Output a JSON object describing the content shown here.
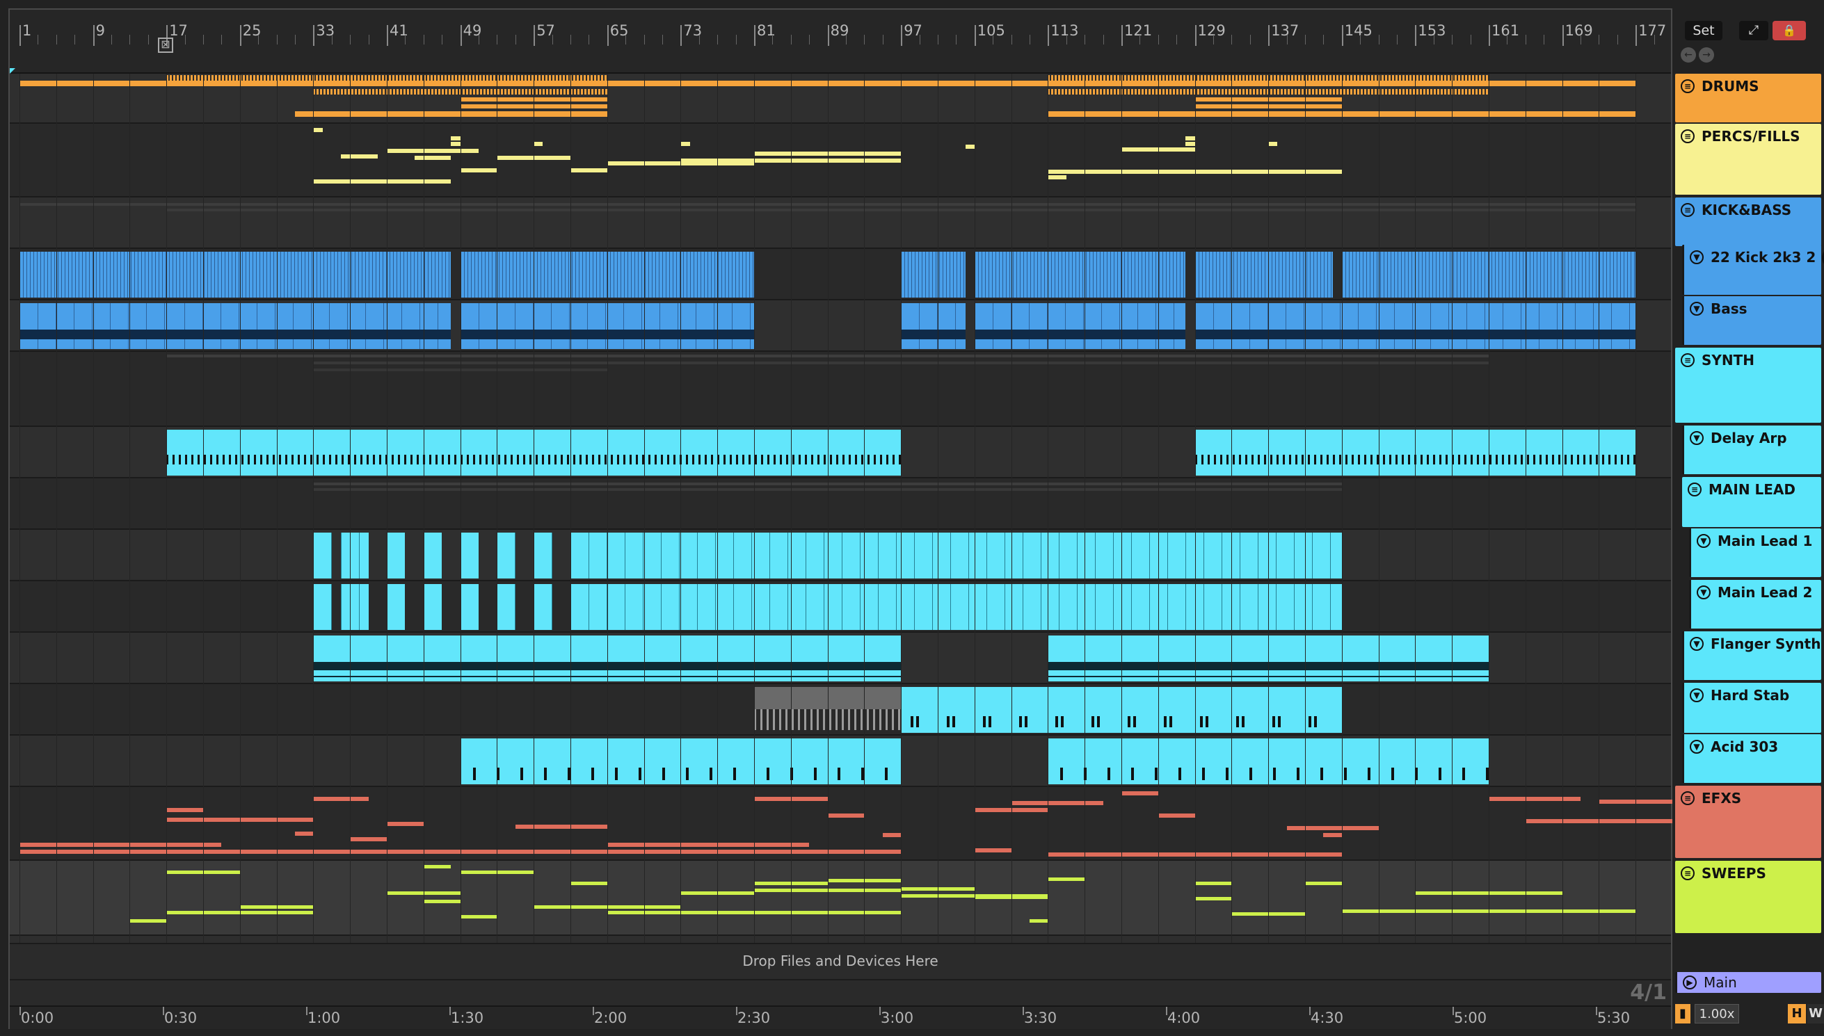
{
  "ruler": {
    "bars": [
      "1",
      "9",
      "17",
      "25",
      "33",
      "41",
      "49",
      "57",
      "65",
      "73",
      "81",
      "89",
      "97",
      "105",
      "113",
      "121",
      "129",
      "137",
      "145",
      "153",
      "161",
      "169",
      "177"
    ]
  },
  "time": {
    "labels": [
      "0:00",
      "0:30",
      "1:00",
      "1:30",
      "2:00",
      "2:30",
      "3:00",
      "3:30",
      "4:00",
      "4:30",
      "5:00",
      "5:30"
    ]
  },
  "controls": {
    "set_label": "Set",
    "expand_icon": "expand-arrows-icon",
    "lock_icon": "lock-icon",
    "back_icon": "nav-back-icon",
    "forward_icon": "nav-forward-icon",
    "zoom": "1.00x",
    "h_label": "H",
    "w_label": "W",
    "time_signature": "4/1"
  },
  "drop_text": "Drop Files and Devices Here",
  "tracks": [
    {
      "name": "DRUMS",
      "type": "group",
      "color": "#f5a33c"
    },
    {
      "name": "PERCS/FILLS",
      "type": "group",
      "color": "#f7f191"
    },
    {
      "name": "KICK&BASS",
      "type": "group",
      "color": "#4aa0ea"
    },
    {
      "name": "22 Kick 2k3 2 (",
      "type": "track",
      "color": "#4aa0ea"
    },
    {
      "name": "Bass",
      "type": "track",
      "color": "#4aa0ea"
    },
    {
      "name": "SYNTH",
      "type": "group",
      "color": "#5ce6fb"
    },
    {
      "name": "Delay Arp",
      "type": "track",
      "color": "#5ce6fb"
    },
    {
      "name": "MAIN LEAD",
      "type": "group",
      "color": "#5ce6fb"
    },
    {
      "name": "Main Lead 1",
      "type": "track",
      "color": "#5ce6fb"
    },
    {
      "name": "Main Lead 2",
      "type": "track",
      "color": "#5ce6fb"
    },
    {
      "name": "Flanger Synth",
      "type": "track",
      "color": "#5ce6fb"
    },
    {
      "name": "Hard Stab",
      "type": "track",
      "color": "#5ce6fb"
    },
    {
      "name": "Acid 303",
      "type": "track",
      "color": "#5ce6fb"
    },
    {
      "name": "EFXS",
      "type": "group",
      "color": "#e07563"
    },
    {
      "name": "SWEEPS",
      "type": "group",
      "color": "#cdf04a"
    },
    {
      "name": "Main",
      "type": "main",
      "color": "#9f9fff"
    }
  ]
}
